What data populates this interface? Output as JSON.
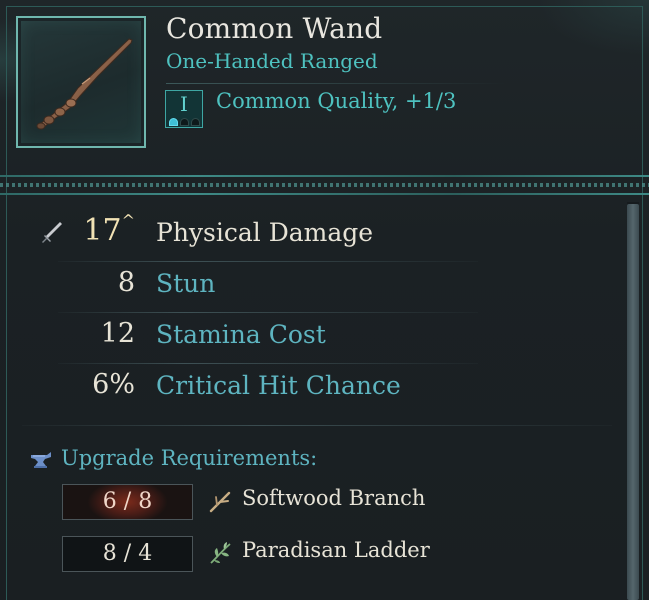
{
  "item": {
    "name": "Common Wand",
    "type": "One-Handed Ranged",
    "tier_numeral": "I",
    "tier_pips_filled": 1,
    "tier_pips_total": 3,
    "quality": "Common Quality, +1/3",
    "icon": "wand-icon"
  },
  "stats": [
    {
      "value": "17",
      "label": "Physical Damage",
      "icon": "sword-icon",
      "upgrade_indicator": "^"
    },
    {
      "value": "8",
      "label": "Stun"
    },
    {
      "value": "12",
      "label": "Stamina Cost"
    },
    {
      "value": "6%",
      "label": "Critical Hit Chance"
    }
  ],
  "upgrade": {
    "title": "Upgrade Requirements:",
    "icon": "anvil-icon",
    "requirements": [
      {
        "count": "6 / 8",
        "have": 6,
        "need": 8,
        "name": "Softwood Branch",
        "icon": "branch-icon",
        "status": "insufficient"
      },
      {
        "count": "8 / 4",
        "have": 8,
        "need": 4,
        "name": "Paradisan Ladder",
        "icon": "herb-icon",
        "status": "sufficient"
      }
    ]
  },
  "colors": {
    "accent_teal": "#4ec2c0",
    "primary_text": "#e7e3d6",
    "highlight_value": "#f2e3b5",
    "insufficient_red": "#7a2a1b",
    "background": "#1c2226"
  }
}
